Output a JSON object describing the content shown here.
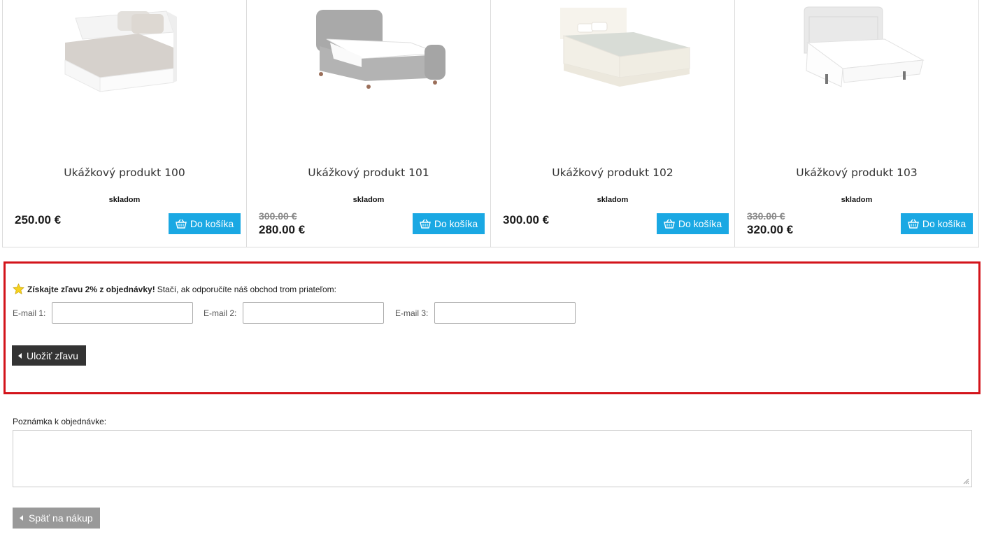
{
  "products": [
    {
      "title": "Ukážkový produkt 100",
      "stock": "skladom",
      "old_price": "",
      "price": "250.00 €",
      "cart_label": "Do košíka",
      "image": "white-wooden-bed-image"
    },
    {
      "title": "Ukážkový produkt 101",
      "stock": "skladom",
      "old_price": "300.00 €",
      "price": "280.00 €",
      "cart_label": "Do košíka",
      "image": "grey-upholstered-bed-image"
    },
    {
      "title": "Ukážkový produkt 102",
      "stock": "skladom",
      "old_price": "",
      "price": "300.00 €",
      "cart_label": "Do košíka",
      "image": "cream-boxspring-bed-image"
    },
    {
      "title": "Ukážkový produkt 103",
      "stock": "skladom",
      "old_price": "330.00 €",
      "price": "320.00 €",
      "cart_label": "Do košíka",
      "image": "white-wingback-bed-image"
    }
  ],
  "discount": {
    "headline": "Získajte zľavu 2% z objednávky!",
    "text": "Stačí, ak odporučíte náš obchod trom priateľom:",
    "fields": [
      {
        "label": "E-mail 1:",
        "value": ""
      },
      {
        "label": "E-mail 2:",
        "value": ""
      },
      {
        "label": "E-mail 3:",
        "value": ""
      }
    ],
    "save_label": "Uložiť zľavu",
    "border_color": "#d3141b"
  },
  "note": {
    "label": "Poznámka k objednávke:",
    "value": ""
  },
  "back_label": "Späť na nákup",
  "colors": {
    "accent": "#1aa8e3",
    "dark_button": "#333333",
    "grey_button": "#999999"
  }
}
